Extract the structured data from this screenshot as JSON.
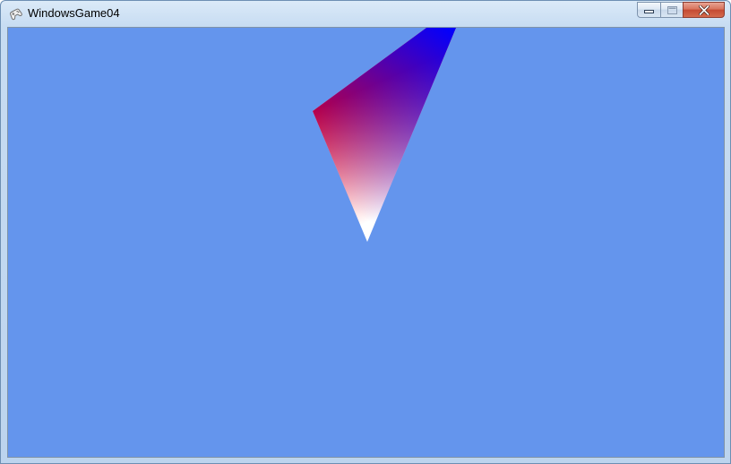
{
  "window": {
    "title": "WindowsGame04",
    "icon": "gamepad-icon",
    "controls": {
      "minimize_icon": "minimize-icon",
      "maximize_icon": "maximize-icon",
      "close_icon": "close-icon"
    }
  },
  "colors": {
    "clear_color": "#6495ed",
    "vertex_red": "#ff0000",
    "vertex_blue": "#0000ff",
    "vertex_white": "#ffffff"
  }
}
